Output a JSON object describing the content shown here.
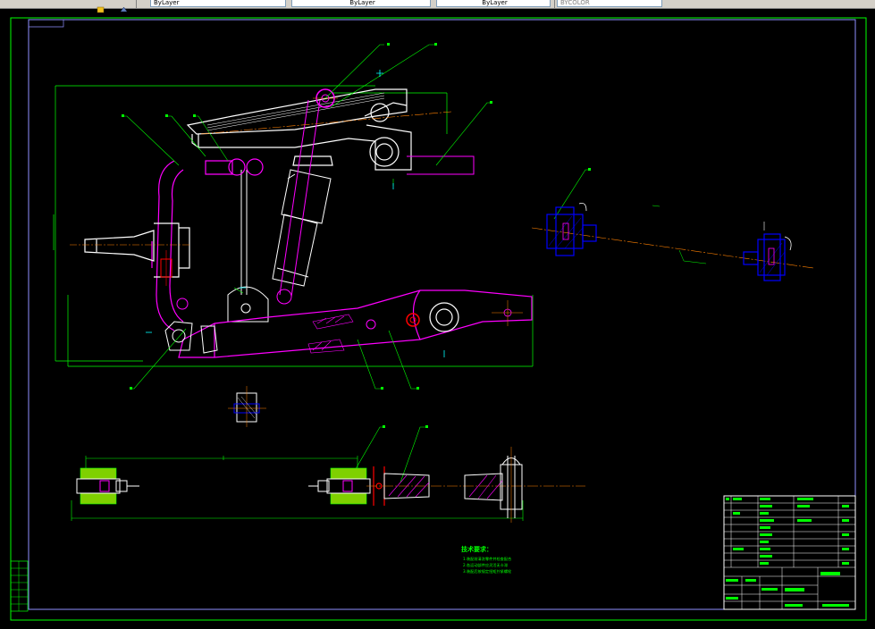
{
  "window": {
    "toolbar_fields": [
      {
        "id": "layer",
        "value": "ByLayer"
      },
      {
        "id": "linetype",
        "value": "ByLayer"
      },
      {
        "id": "lineweight",
        "value": "ByLayer"
      },
      {
        "id": "plotstyle",
        "value": "BYCOLOR"
      }
    ]
  },
  "drawing": {
    "notes_title": "技术要求：",
    "notes": [
      "1.装配前清洗零件并检查配合",
      "2.各运动部件应灵活无卡滞",
      "3.装配后按规定扭矩拧紧螺栓"
    ],
    "colors": {
      "background": "#000000",
      "frame": "#00ff00",
      "outline": "#ffffff",
      "part": "#ff00ff",
      "leader": "#00ff00",
      "centerline": "#ff8000",
      "section": "#0000ff",
      "highlight": "#ff0000"
    }
  }
}
